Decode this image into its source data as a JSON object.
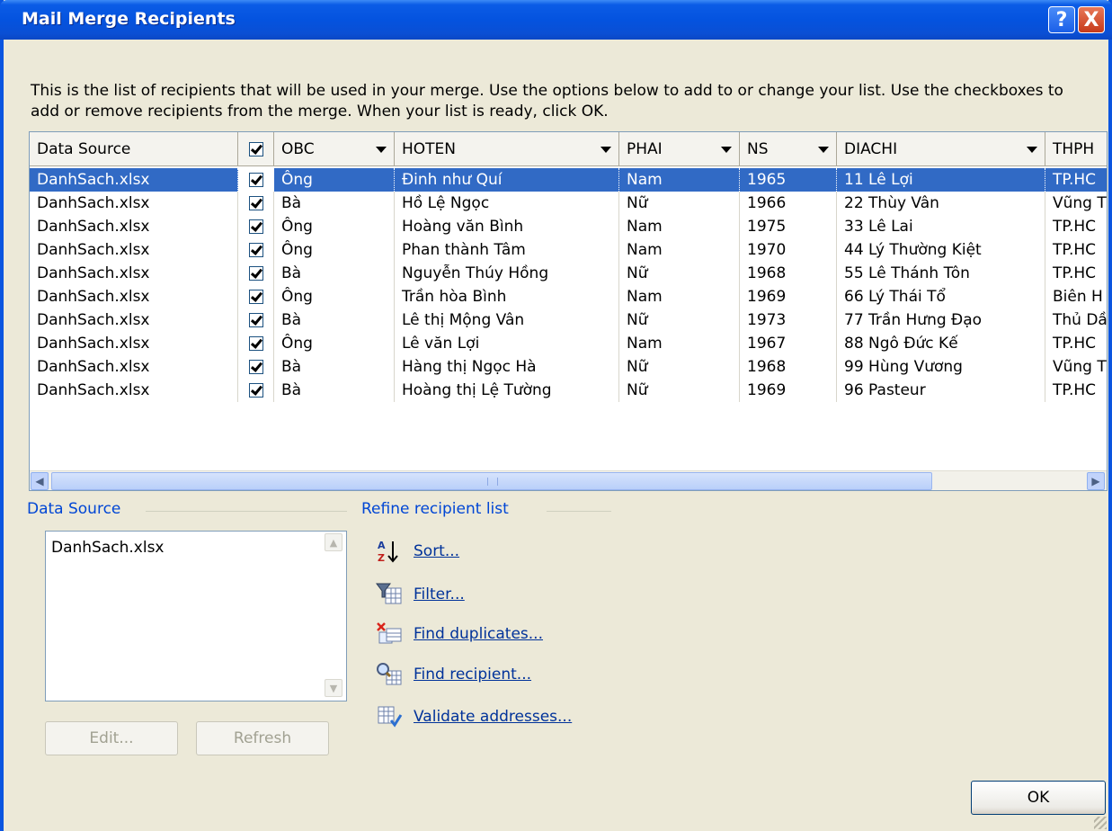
{
  "window": {
    "title": "Mail Merge Recipients",
    "help_label": "?",
    "close_label": "X"
  },
  "description": "This is the list of recipients that will be used in your merge.  Use the options below to add to or change your list.  Use the checkboxes to add or remove recipients from the merge.  When your list is ready, click OK.",
  "table": {
    "headers": [
      "Data Source",
      "",
      "OBC",
      "HOTEN",
      "PHAI",
      "NS",
      "DIACHI",
      "THPH"
    ],
    "rows": [
      {
        "source": "DanhSach.xlsx",
        "obc": "Ông",
        "hoten": "Đinh như Quí",
        "phai": "Nam",
        "ns": "1965",
        "diachi": "11 Lê Lợi",
        "thph": "TP.HC"
      },
      {
        "source": "DanhSach.xlsx",
        "obc": "Bà",
        "hoten": "Hồ Lệ Ngọc",
        "phai": "Nữ",
        "ns": "1966",
        "diachi": "22 Thùy Vân",
        "thph": "Vũng T"
      },
      {
        "source": "DanhSach.xlsx",
        "obc": "Ông",
        "hoten": "Hoàng văn Bình",
        "phai": "Nam",
        "ns": "1975",
        "diachi": "33 Lê Lai",
        "thph": "TP.HC"
      },
      {
        "source": "DanhSach.xlsx",
        "obc": "Ông",
        "hoten": "Phan thành Tâm",
        "phai": "Nam",
        "ns": "1970",
        "diachi": "44 Lý Thường Kiệt",
        "thph": "TP.HC"
      },
      {
        "source": "DanhSach.xlsx",
        "obc": "Bà",
        "hoten": "Nguyễn Thúy Hồng",
        "phai": "Nữ",
        "ns": "1968",
        "diachi": "55 Lê Thánh Tôn",
        "thph": "TP.HC"
      },
      {
        "source": "DanhSach.xlsx",
        "obc": "Ông",
        "hoten": "Trần hòa Bình",
        "phai": "Nam",
        "ns": "1969",
        "diachi": "66 Lý Thái Tổ",
        "thph": "Biên H"
      },
      {
        "source": "DanhSach.xlsx",
        "obc": "Bà",
        "hoten": "Lê thị Mộng Vân",
        "phai": "Nữ",
        "ns": "1973",
        "diachi": "77 Trần Hưng Đạo",
        "thph": "Thủ Dầ"
      },
      {
        "source": "DanhSach.xlsx",
        "obc": "Ông",
        "hoten": "Lê văn Lợi",
        "phai": "Nam",
        "ns": "1967",
        "diachi": "88 Ngô Đức Kế",
        "thph": "TP.HC"
      },
      {
        "source": "DanhSach.xlsx",
        "obc": "Bà",
        "hoten": "Hàng thị Ngọc Hà",
        "phai": "Nữ",
        "ns": "1968",
        "diachi": "99 Hùng Vương",
        "thph": "Vũng T"
      },
      {
        "source": "DanhSach.xlsx",
        "obc": "Bà",
        "hoten": "Hoàng thị Lệ Tường",
        "phai": "Nữ",
        "ns": "1969",
        "diachi": "96 Pasteur",
        "thph": "TP.HC"
      }
    ],
    "scroll_grip": "III"
  },
  "data_source": {
    "label": "Data Source",
    "item": "DanhSach.xlsx",
    "edit_label": "Edit...",
    "refresh_label": "Refresh"
  },
  "refine": {
    "label": "Refine recipient list",
    "links": [
      {
        "label": "Sort...",
        "icon": "sort-az-icon"
      },
      {
        "label": "Filter...",
        "icon": "filter-icon"
      },
      {
        "label": "Find duplicates...",
        "icon": "find-duplicates-icon"
      },
      {
        "label": "Find recipient...",
        "icon": "find-recipient-icon"
      },
      {
        "label": "Validate addresses...",
        "icon": "validate-addresses-icon"
      }
    ]
  },
  "ok_label": "OK",
  "colors": {
    "title_blue": "#0453df",
    "selection": "#316ac5",
    "dialog_bg": "#ece9d8",
    "link": "#00329a",
    "group_label": "#0046d5"
  }
}
